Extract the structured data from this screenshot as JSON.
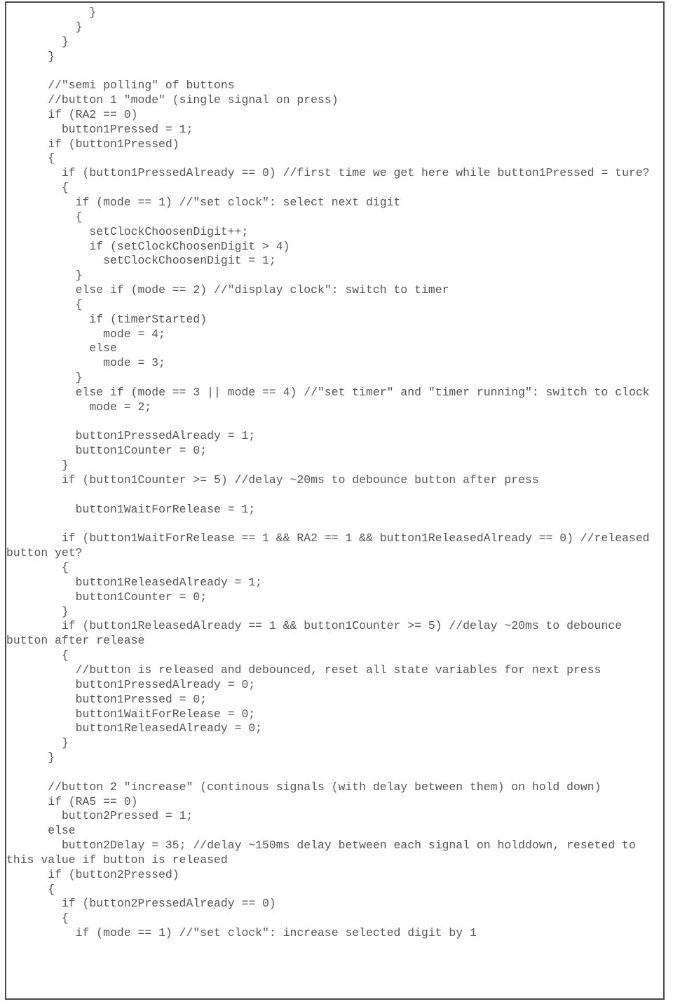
{
  "document": {
    "kind": "source-code-listing",
    "language": "c",
    "text_color": "#555555",
    "border_color": "#4a4a4a",
    "background_color": "#ffffff",
    "font": "monospace",
    "lines": [
      "            }",
      "          }",
      "        }",
      "      }",
      "",
      "      //\"semi polling\" of buttons",
      "      //button 1 \"mode\" (single signal on press)",
      "      if (RA2 == 0)",
      "        button1Pressed = 1;",
      "      if (button1Pressed)",
      "      {",
      "        if (button1PressedAlready == 0) //first time we get here while button1Pressed = ture?",
      "        {",
      "          if (mode == 1) //\"set clock\": select next digit",
      "          {",
      "            setClockChoosenDigit++;",
      "            if (setClockChoosenDigit > 4)",
      "              setClockChoosenDigit = 1;",
      "          }",
      "          else if (mode == 2) //\"display clock\": switch to timer",
      "          {",
      "            if (timerStarted)",
      "              mode = 4;",
      "            else",
      "              mode = 3;",
      "          }",
      "          else if (mode == 3 || mode == 4) //\"set timer\" and \"timer running\": switch to clock",
      "            mode = 2;",
      "",
      "          button1PressedAlready = 1;",
      "          button1Counter = 0;",
      "        }",
      "        if (button1Counter >= 5) //delay ~20ms to debounce button after press",
      "",
      "          button1WaitForRelease = 1;",
      "",
      "        if (button1WaitForRelease == 1 && RA2 == 1 && button1ReleasedAlready == 0) //released button yet?",
      "        {",
      "          button1ReleasedAlready = 1;",
      "          button1Counter = 0;",
      "        }",
      "        if (button1ReleasedAlready == 1 && button1Counter >= 5) //delay ~20ms to debounce button after release",
      "        {",
      "          //button is released and debounced, reset all state variables for next press",
      "          button1PressedAlready = 0;",
      "          button1Pressed = 0;",
      "          button1WaitForRelease = 0;",
      "          button1ReleasedAlready = 0;",
      "        }",
      "      }",
      "",
      "      //button 2 \"increase\" (continous signals (with delay between them) on hold down)",
      "      if (RA5 == 0)",
      "        button2Pressed = 1;",
      "      else",
      "        button2Delay = 35; //delay ~150ms delay between each signal on holddown, reseted to this value if button is released",
      "      if (button2Pressed)",
      "      {",
      "        if (button2PressedAlready == 0)",
      "        {",
      "          if (mode == 1) //\"set clock\": increase selected digit by 1"
    ]
  }
}
